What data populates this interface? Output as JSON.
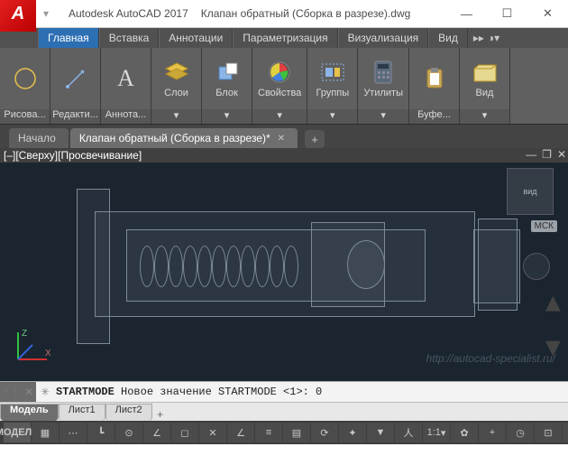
{
  "title": {
    "app": "Autodesk AutoCAD 2017",
    "file": "Клапан обратный (Сборка в разрезе).dwg"
  },
  "menu": {
    "items": [
      "Главная",
      "Вставка",
      "Аннотации",
      "Параметризация",
      "Визуализация",
      "Вид"
    ],
    "active": 0
  },
  "ribbon_panels": [
    {
      "label": "Рисова...",
      "icon": "circle"
    },
    {
      "label": "Редакти...",
      "icon": "move"
    },
    {
      "label": "Аннота...",
      "icon": "text",
      "glyph": "A"
    },
    {
      "label": "Слои",
      "icon": "layers"
    },
    {
      "label": "Блок",
      "icon": "block"
    },
    {
      "label": "Свойства",
      "icon": "palette"
    },
    {
      "label": "Группы",
      "icon": "group",
      "top_label": "Группы"
    },
    {
      "label": "Утилиты",
      "icon": "calc",
      "top_label": "Утилиты"
    },
    {
      "label": "Буфе...",
      "icon": "clipboard"
    },
    {
      "label": "Вид",
      "icon": "folder",
      "top_label": "Вид"
    }
  ],
  "file_tabs": {
    "items": [
      {
        "label": "Начало"
      },
      {
        "label": "Клапан обратный (Сборка в разрезе)*",
        "active": true
      }
    ]
  },
  "viewport": {
    "corner": "[–][Сверху][Просвечивание]",
    "wcs": "МСК",
    "cube": "вид",
    "watermark": "http://autocad-specialist.ru/"
  },
  "command": {
    "text_bold": "STARTMODE",
    "text_rest": " Новое значение STARTMODE <1>:  0"
  },
  "layout_tabs": {
    "items": [
      "Модель",
      "Лист1",
      "Лист2"
    ],
    "active": 0
  },
  "status": {
    "model": "МОДЕЛЬ",
    "scale": "1:1"
  }
}
